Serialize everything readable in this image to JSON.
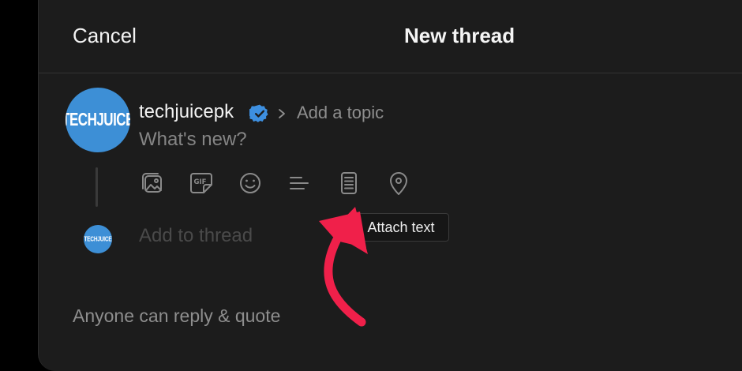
{
  "header": {
    "cancel_label": "Cancel",
    "title": "New thread"
  },
  "composer": {
    "avatar_text": "TECHJUICE",
    "username": "techjuicepk",
    "verified_icon": "verified-badge-icon",
    "topic_placeholder": "Add a topic",
    "body_placeholder": "What's new?",
    "toolbar": [
      {
        "name": "attach-media",
        "icon": "image-gallery-icon"
      },
      {
        "name": "gif",
        "icon": "gif-icon"
      },
      {
        "name": "emoji",
        "icon": "emoji-icon"
      },
      {
        "name": "poll",
        "icon": "poll-lines-icon"
      },
      {
        "name": "attach-text",
        "icon": "document-icon"
      },
      {
        "name": "location",
        "icon": "location-pin-icon"
      }
    ],
    "tooltip": "Attach text"
  },
  "add_thread": {
    "avatar_text": "TECHJUICE",
    "placeholder": "Add to thread"
  },
  "footer": {
    "reply_setting": "Anyone can reply & quote"
  },
  "colors": {
    "panel_bg": "#1c1c1c",
    "avatar_blue": "#3d8fd6",
    "verified_blue": "#3d8fe0",
    "arrow_red": "#f0204a"
  }
}
